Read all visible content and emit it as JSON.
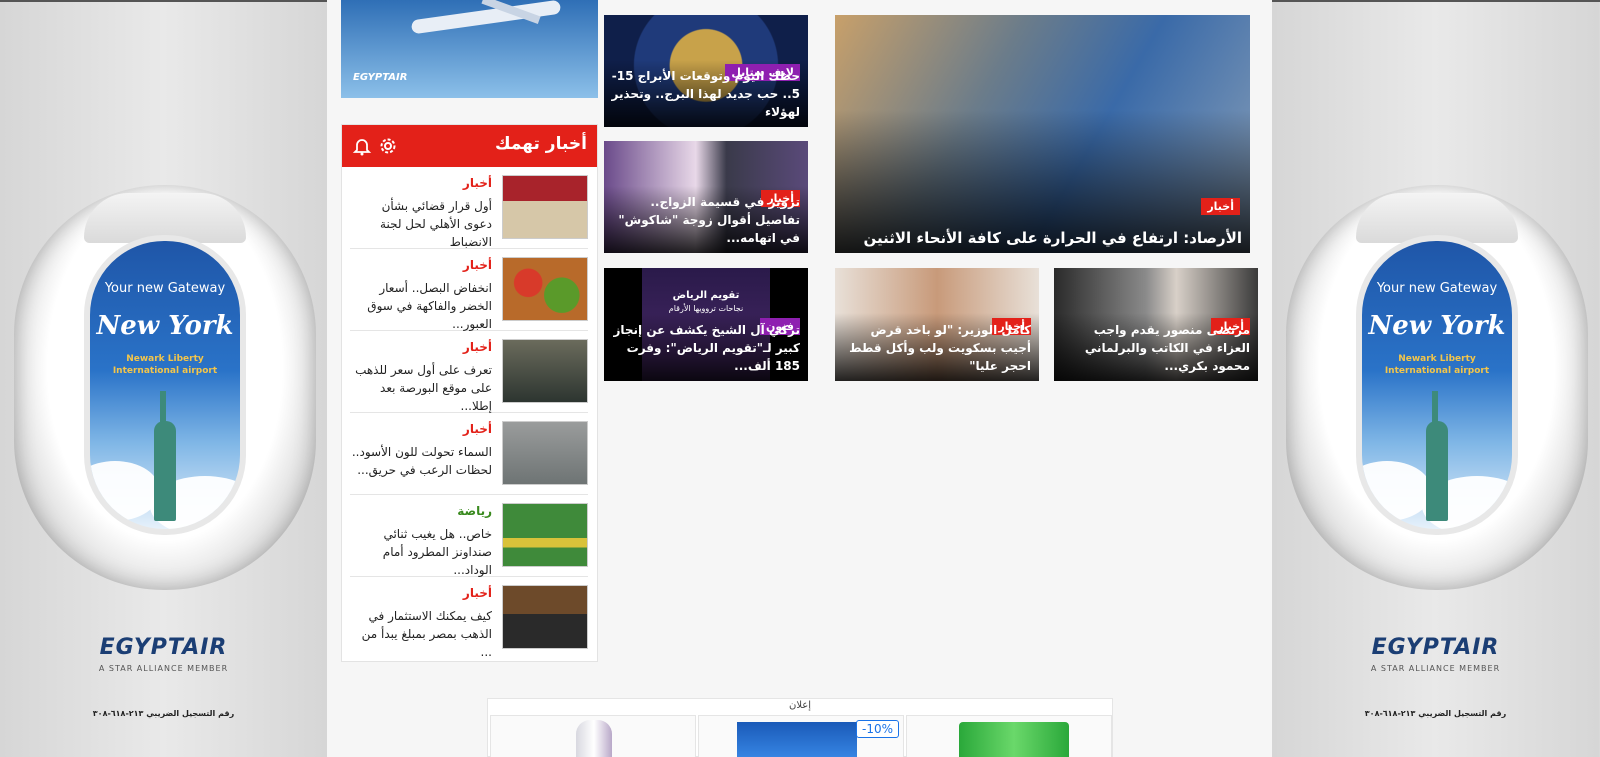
{
  "side_ads": {
    "headline1": "Your new Gateway",
    "headline2": "New York",
    "headline3": "Newark Liberty International airport",
    "brand": "EGYPTAIR",
    "brand_sub": "A STAR ALLIANCE MEMBER",
    "reg": "رقم التسجيل الضريبي ٢١٣-٦١٨-٣٠٨"
  },
  "top_ad": {
    "brand": "EGYPTAIR"
  },
  "news_box": {
    "title": "أخبار تهمك",
    "items": [
      {
        "category": "أخبار",
        "text": "أول قرار قضائي بشأن دعوى الأهلي لحل لجنة الانضباط"
      },
      {
        "category": "أخبار",
        "text": "انخفاض البصل.. أسعار الخضر والفاكهة في سوق العبور..."
      },
      {
        "category": "أخبار",
        "text": "تعرف على أول سعر للذهب على موقع البورصة بعد إطلا..."
      },
      {
        "category": "أخبار",
        "text": "السماء تحولت للون الأسود.. لحظات الرعب في حريق..."
      },
      {
        "category": "رياضة",
        "text": "خاص.. هل يغيب ثنائي صنداونز المطرود أمام الوداد..."
      },
      {
        "category": "أخبار",
        "text": "كيف يمكنك الاستثمار في الذهب بمصر بمبلغ يبدأ من ..."
      }
    ]
  },
  "tiles": {
    "main": {
      "category": "أخبار",
      "headline": "الأرصاد: ارتفاع في الحرارة على كافة الأنحاء الاثنين"
    },
    "horoscope": {
      "category": "لايف ستايل",
      "headline": "حظك اليوم وتوقعات الأبراج 15-5.. حب جديد لهذا البرج.. وتحذير لهؤلاء"
    },
    "wedding": {
      "category": "أخبار",
      "headline": "تزوير في قسيمة الزواج.. تفاصيل أقوال زوجة \"شاكوش\" في اتهامه..."
    },
    "riyadh": {
      "category": "فنون",
      "headline": "تركي آل الشيخ يكشف عن إنجاز كبير لـ\"تقويم الرياض\": وفرت 185 ألف...",
      "poster_title": "تقويم الرياض",
      "poster_sub": "نجاحات تروويها الأرقام"
    },
    "minister": {
      "category": "أخبار",
      "headline": "كامل الوزير: \"لو باخد قرض أجيب بسكويت ولب وأكل قطط احجر عليا\""
    },
    "condolence": {
      "category": "أخبار",
      "headline": "مرتضى منصور يقدم واجب العزاء في الكاتب والبرلماني محمود بكري..."
    }
  },
  "bottom_ad": {
    "label": "إعلان",
    "discount": "-10%",
    "close": "✕",
    "info": "ⓘ"
  }
}
